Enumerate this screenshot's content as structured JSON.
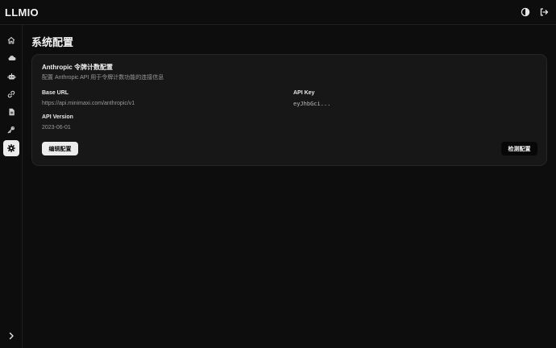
{
  "app": {
    "brand": "LLMIO"
  },
  "header": {
    "theme_icon": "theme-toggle-icon",
    "logout_icon": "logout-icon"
  },
  "sidebar": {
    "items": [
      {
        "icon": "home-icon"
      },
      {
        "icon": "cloud-icon"
      },
      {
        "icon": "robot-icon"
      },
      {
        "icon": "link-icon"
      },
      {
        "icon": "document-icon"
      },
      {
        "icon": "key-icon"
      },
      {
        "icon": "gear-icon",
        "active": true
      }
    ],
    "collapse_icon": "chevron-right-icon"
  },
  "page": {
    "title": "系统配置"
  },
  "card": {
    "title": "Anthropic 令牌计数配置",
    "description": "配置 Anthropic API 用于令牌计数功能的连接信息",
    "base_url_label": "Base URL",
    "base_url_value": "https://api.minimaxi.com/anthropic/v1",
    "api_key_label": "API Key",
    "api_key_value": "eyJhbGci...",
    "api_version_label": "API Version",
    "api_version_value": "2023-06-01",
    "edit_button": "编辑配置",
    "test_button": "检测配置"
  },
  "colors": {
    "background": "#0d0d0d",
    "card": "#171717",
    "accent_light": "#ececec"
  }
}
